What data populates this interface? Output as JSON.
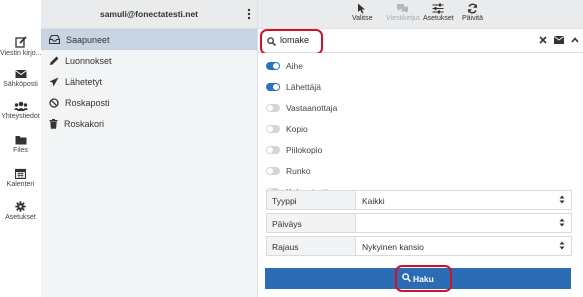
{
  "rail": [
    {
      "label": "Viestin kirjo...",
      "icon": "compose-icon"
    },
    {
      "label": "Sähköposti",
      "icon": "envelope-icon"
    },
    {
      "label": "Yhteystiedot",
      "icon": "users-icon"
    },
    {
      "label": "Files",
      "icon": "folder-icon"
    },
    {
      "label": "Kalenteri",
      "icon": "calendar-icon"
    },
    {
      "label": "Asetukset",
      "icon": "gear-icon"
    }
  ],
  "account": "samuli@fonectatesti.net",
  "folders": [
    {
      "label": "Saapuneet",
      "icon": "inbox-icon",
      "selected": true
    },
    {
      "label": "Luonnokset",
      "icon": "pencil-icon",
      "selected": false
    },
    {
      "label": "Lähetetyt",
      "icon": "paper-plane-icon",
      "selected": false
    },
    {
      "label": "Roskaposti",
      "icon": "ban-icon",
      "selected": false
    },
    {
      "label": "Roskakori",
      "icon": "trash-icon",
      "selected": false
    }
  ],
  "toolbar": {
    "select": "Valitse",
    "threads": "Viestiketjut",
    "settings": "Asetukset",
    "refresh": "Päivitä"
  },
  "search": {
    "value": "lomake"
  },
  "scope_options": [
    {
      "label": "Aihe",
      "on": true
    },
    {
      "label": "Lähettäjä",
      "on": true
    },
    {
      "label": "Vastaanottaja",
      "on": false
    },
    {
      "label": "Kopio",
      "on": false
    },
    {
      "label": "Piilokopio",
      "on": false
    },
    {
      "label": "Runko",
      "on": false
    },
    {
      "label": "Koko viesti",
      "on": false
    }
  ],
  "filters": [
    {
      "label": "Tyyppi",
      "value": "Kaikki"
    },
    {
      "label": "Päiväys",
      "value": ""
    },
    {
      "label": "Rajaus",
      "value": "Nykyinen kansio"
    }
  ],
  "search_button": "Haku",
  "colors": {
    "accent": "#2b6cb4",
    "highlight": "#d2102c",
    "selected_folder": "#c8d4e1"
  }
}
